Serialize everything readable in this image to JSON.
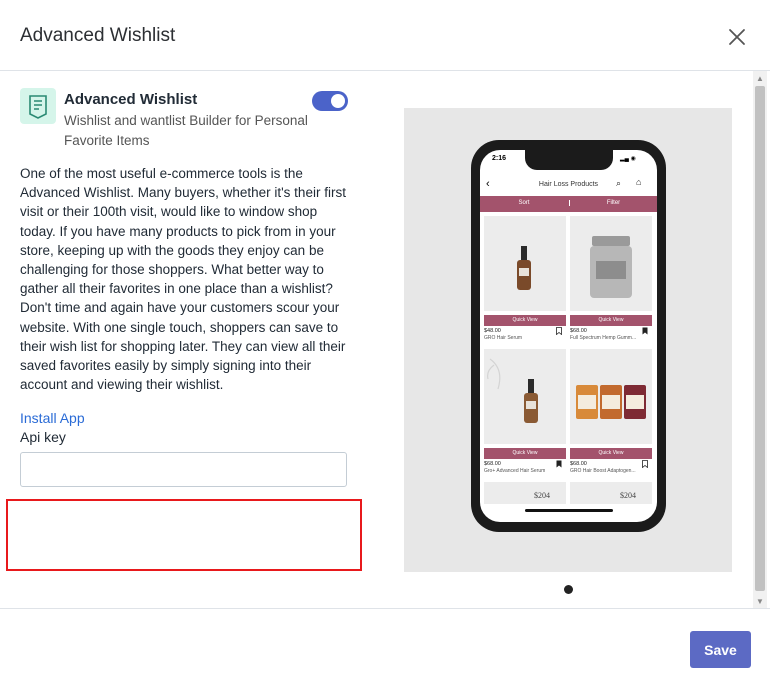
{
  "header": {
    "title": "Advanced Wishlist"
  },
  "app": {
    "name": "Advanced Wishlist",
    "subtitle": "Wishlist and wantlist Builder for Personal Favorite Items",
    "enabled": true,
    "description": "One of the most useful e-commerce tools is the Advanced Wishlist. Many buyers, whether it's their first visit or their 100th visit, would like to window shop today. If you have many products to pick from in your store, keeping up with the goods they enjoy can be challenging for those shoppers. What better way to gather all their favorites in one place than a wishlist? Don't time and again have your customers scour your website. With one single touch, shoppers can save to their wish list for shopping later. They can view all their saved favorites easily by simply signing into their account and viewing their wishlist.",
    "install_link": "Install App",
    "api_key_label": "Api key",
    "api_key_value": ""
  },
  "preview": {
    "phone": {
      "time": "2:16",
      "title": "Hair Loss Products",
      "sort_label": "Sort",
      "filter_label": "Filter",
      "quick_view": "Quick View",
      "products": [
        {
          "price": "$48.00",
          "name": "GRO Hair Serum"
        },
        {
          "price": "$68.00",
          "name": "Full Spectrum Hemp Gumm..."
        },
        {
          "price": "$68.00",
          "name": "Gro+ Advanced Hair Serum"
        },
        {
          "price": "$68.00",
          "name": "GRO Hair Boost Adaptogen..."
        }
      ],
      "bottom_prices": [
        "$204",
        "$204"
      ]
    },
    "slide_count": 1
  },
  "footer": {
    "save_label": "Save"
  },
  "colors": {
    "accent": "#5c6ac4",
    "toggle": "#4b63c9",
    "link": "#2a6bd6",
    "highlight": "#e8191c",
    "brand_bar": "#a3536c"
  }
}
